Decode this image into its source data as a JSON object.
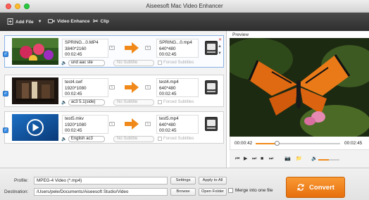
{
  "window": {
    "title": "Aiseesoft Mac Video Enhancer"
  },
  "toolbar": {
    "add_file": "Add File",
    "video_enhance": "Video Enhance",
    "clip": "Clip"
  },
  "files": [
    {
      "source_name": "SPRING...0.MP4",
      "source_res": "3840*2160",
      "source_duration": "00:02:45",
      "output_name": "SPRING...0.mp4",
      "output_res": "640*480",
      "output_duration": "00:02:45",
      "audio": "und aac ste",
      "subtitle": "No Subtitle",
      "forced": "Forced Subtitles",
      "selected": true
    },
    {
      "source_name": "test4.swf",
      "source_res": "1920*1080",
      "source_duration": "00:02:45",
      "output_name": "test4.mp4",
      "output_res": "640*480",
      "output_duration": "00:02:45",
      "audio": "ac3 5.1(side)",
      "subtitle": "No Subtitle",
      "forced": "Forced Subtitles",
      "selected": false
    },
    {
      "source_name": "test5.mkv",
      "source_res": "1920*1080",
      "source_duration": "00:02:45",
      "output_name": "test5.mp4",
      "output_res": "640*480",
      "output_duration": "00:02:45",
      "audio": "English ac3",
      "subtitle": "No Subtitle",
      "forced": "Forced Subtitles",
      "selected": false
    }
  ],
  "preview": {
    "label": "Preview",
    "current_time": "00:00:42",
    "total_time": "00:02:45",
    "progress": 0.25,
    "volume": 0.5
  },
  "bottom": {
    "profile_label": "Profile:",
    "profile_value": "MPEG-4 Video (*.mp4)",
    "settings": "Settings",
    "apply_all": "Apply to All",
    "destination_label": "Destination:",
    "destination_value": "/Users/pele/Documents/Aiseesoft Studio/Video",
    "browse": "Browse",
    "open_folder": "Open Folder",
    "merge": "Merge into one file",
    "convert": "Convert"
  },
  "colors": {
    "accent": "#f0891a",
    "checkbox": "#3a8ee6"
  }
}
